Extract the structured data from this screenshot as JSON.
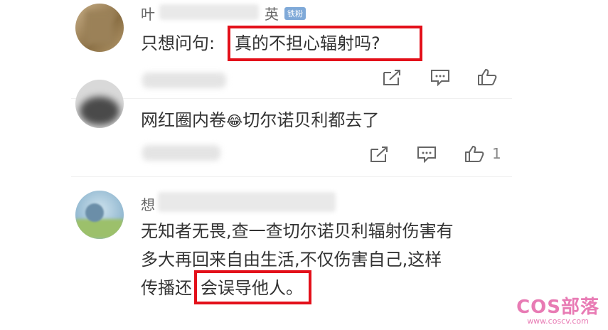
{
  "comments": [
    {
      "name_prefix": "叶",
      "name_suffix": "英",
      "badge": "铁粉",
      "text_plain": "只想问句:",
      "text_highlight": "真的不担心辐射吗?",
      "likes": ""
    },
    {
      "text_before": "网红圈内卷",
      "emoji": "😂",
      "text_after": "切尔诺贝利都去了",
      "likes": "1"
    },
    {
      "name_prefix": "想",
      "lines": [
        "无知者无畏,查一查切尔诺贝利辐射伤害有",
        "多大再回来自由生活,不仅伤害自己,这样"
      ],
      "line3_plain": "传播还",
      "line3_highlight": "会误导他人。"
    }
  ],
  "watermark": {
    "title": "COS部落",
    "url": "www.coscv.com"
  },
  "icons": [
    "share-icon",
    "comment-icon",
    "like-icon"
  ],
  "colors": {
    "highlight_box": "#e3101a",
    "badge": "#7fa9d8",
    "watermark": "#e87bb4"
  }
}
